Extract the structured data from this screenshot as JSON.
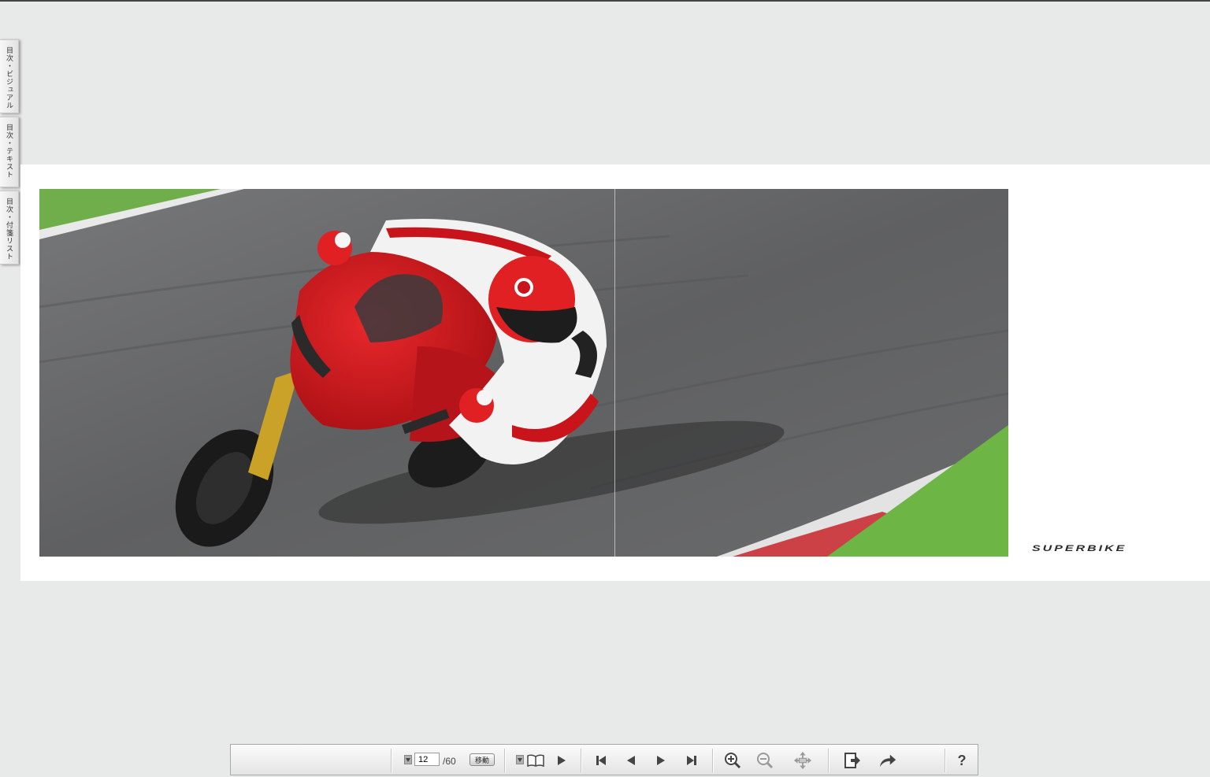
{
  "side_tabs": [
    "目次・ビジュアル",
    "目次・テキスト",
    "目次・付箋リスト"
  ],
  "page": {
    "brand_text": "SUPERBIKE"
  },
  "toolbar": {
    "current_page": "12",
    "total_pages": "/60",
    "go_label": "移動"
  },
  "colors": {
    "background": "#e8e9e9",
    "motorcycle_red": "#c8141a",
    "track_asphalt": "#666768",
    "grass": "#6db544"
  },
  "icons": [
    "page-select-icon",
    "book-view-icon",
    "play-icon",
    "first-page-icon",
    "prev-page-icon",
    "next-page-icon",
    "last-page-icon",
    "zoom-in-icon",
    "zoom-out-icon",
    "pan-icon",
    "exit-icon",
    "share-icon",
    "help-icon"
  ]
}
